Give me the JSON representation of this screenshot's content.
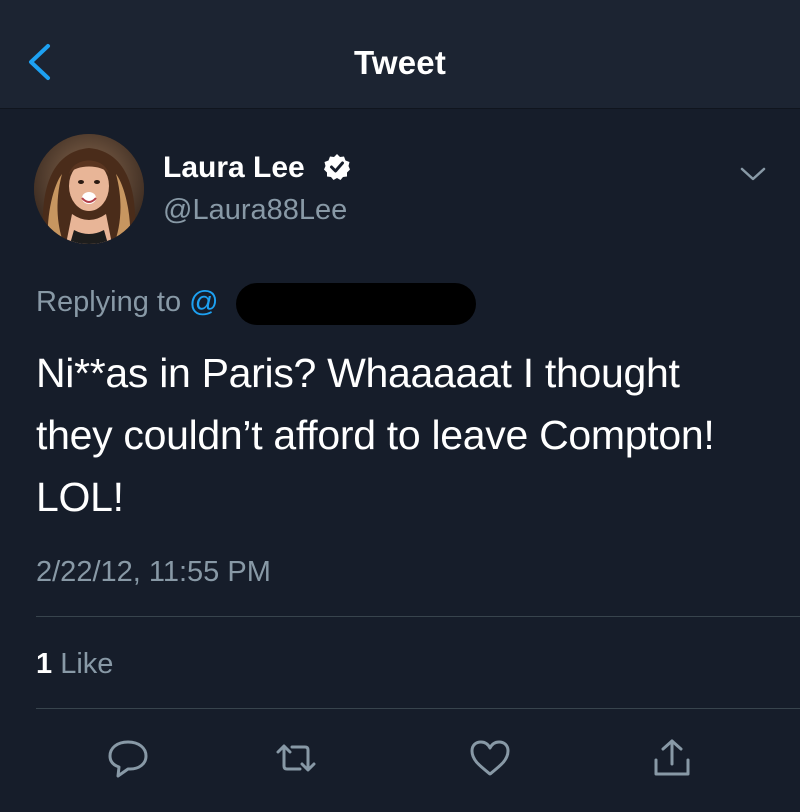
{
  "header": {
    "title": "Tweet",
    "back_icon": "back-chevron-icon"
  },
  "author": {
    "display_name": "Laura Lee",
    "handle": "@Laura88Lee",
    "verified_icon": "verified-badge-icon",
    "menu_icon": "chevron-down-icon"
  },
  "reply": {
    "label": "Replying to",
    "at": "@"
  },
  "tweet": {
    "lines": [
      "Ni**as in Paris? Whaaaaat I thought",
      "they couldn’t afford to leave Compton!",
      "LOL!"
    ],
    "timestamp": "2/22/12, 11:55 PM"
  },
  "stats": {
    "likes_count": "1",
    "likes_label": "Like"
  },
  "actions": [
    "reply-icon",
    "retweet-icon",
    "like-icon",
    "share-icon"
  ],
  "colors": {
    "background": "#161d2a",
    "header": "#1c2432",
    "accent": "#1da1f2",
    "secondary_text": "#8899a6",
    "divider": "#38444d"
  }
}
